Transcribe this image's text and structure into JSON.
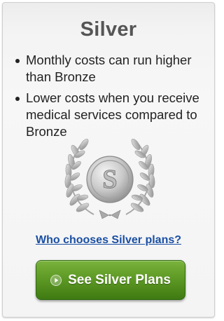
{
  "card": {
    "title": "Silver",
    "bullets": [
      "Monthly costs can run higher than Bronze",
      "Lower costs when you receive medical services compared to Bronze"
    ],
    "medal": {
      "icon": "silver-medal-icon",
      "letter": "S"
    },
    "link_label": "Who chooses Silver plans?",
    "button": {
      "label": "See Silver Plans",
      "icon": "play-circle-icon"
    }
  },
  "colors": {
    "title": "#555555",
    "link": "#1a4fa3",
    "button_green": "#5e9a25",
    "medal_silver": "#b5b5b5"
  }
}
